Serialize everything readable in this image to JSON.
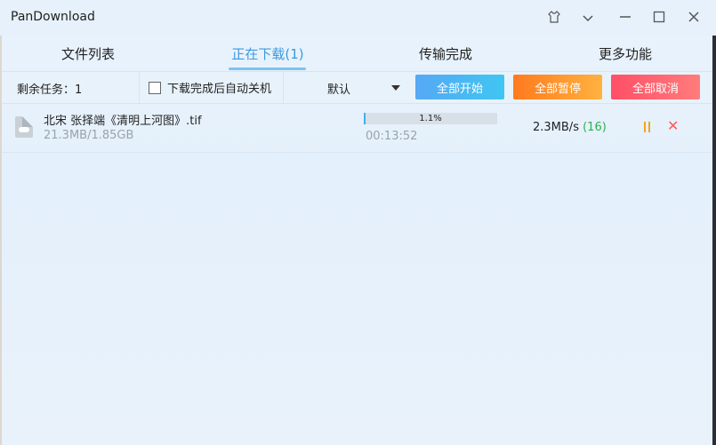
{
  "window": {
    "title": "PanDownload"
  },
  "tabs": [
    {
      "label": "文件列表"
    },
    {
      "label": "正在下载(1)"
    },
    {
      "label": "传输完成"
    },
    {
      "label": "更多功能"
    }
  ],
  "toolbar": {
    "remaining_tasks": "剩余任务：1",
    "shutdown_label": "下载完成后自动关机",
    "sort_value": "默认",
    "start_all": "全部开始",
    "pause_all": "全部暂停",
    "cancel_all": "全部取消"
  },
  "downloads": [
    {
      "name": "北宋 张择端《清明上河图》.tif",
      "size": "21.3MB/1.85GB",
      "progress_text": "1.1%",
      "progress": 0.011,
      "time": "00:13:52",
      "speed": "2.3MB/s",
      "connections": "(16)"
    }
  ],
  "colors": {
    "accent": "#3a9ae0",
    "start": "#56a8f5",
    "pause": "#ff7a1f",
    "cancel": "#ff4f67",
    "connections": "#2bb24c"
  },
  "icons": [
    "skin-icon",
    "dropdown-icon",
    "minimize-icon",
    "maximize-icon",
    "close-icon",
    "file-cloud-icon",
    "pause-icon",
    "cancel-icon"
  ]
}
